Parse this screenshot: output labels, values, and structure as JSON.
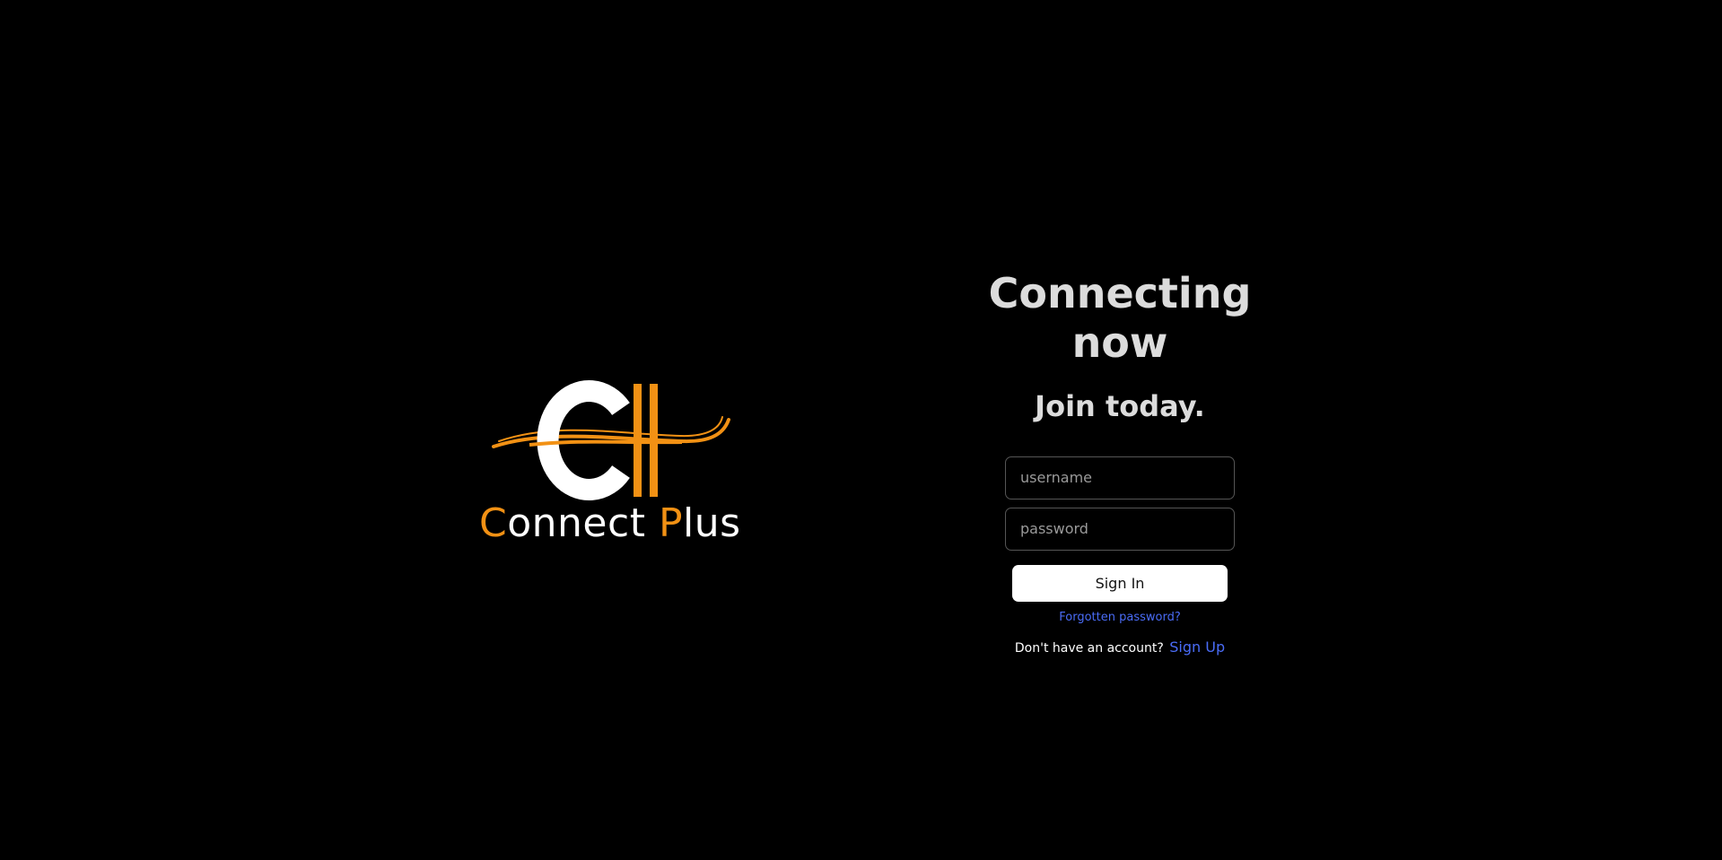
{
  "brand": {
    "wordmark_first_letter": "C",
    "wordmark_first_rest": "onnect",
    "wordmark_second_letter": "P",
    "wordmark_second_rest": "lus",
    "accent_color": "#f29114",
    "text_color": "#ffffff"
  },
  "login": {
    "headline": "Connecting now",
    "subheadline": "Join today.",
    "username_placeholder": "username",
    "password_placeholder": "password",
    "signin_label": "Sign In",
    "forgot_label": "Forgotten password?",
    "no_account_text": "Don't have an account?",
    "signup_label": "Sign Up",
    "link_color": "#4a6cf7"
  }
}
